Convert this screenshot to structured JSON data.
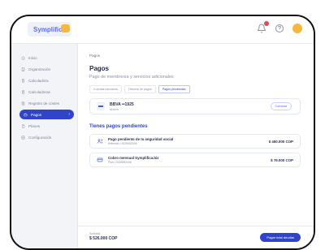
{
  "app": {
    "brand": "Symplifica"
  },
  "nav": {
    "items": [
      {
        "label": "Inicio",
        "icon": "home-icon"
      },
      {
        "label": "Organización",
        "icon": "building-icon"
      },
      {
        "label": "Calculadora",
        "icon": "calculator-icon"
      },
      {
        "label": "Calculadoras",
        "icon": "calculator-icon"
      },
      {
        "label": "Registro de costes",
        "icon": "ledger-icon"
      },
      {
        "label": "Pagos",
        "icon": "wallet-icon",
        "active": true
      },
      {
        "label": "Planes",
        "icon": "document-icon"
      },
      {
        "label": "Configuración",
        "icon": "gear-icon"
      }
    ]
  },
  "page": {
    "breadcrumb": "Pagos",
    "title": "Pagos",
    "subtitle": "Pago de membresía y servicios adicionales",
    "tabs": [
      "Cuentas bancarias",
      "Historial de pagos",
      "Pagos pendientes"
    ]
  },
  "bank": {
    "name": "BBVA ••1925",
    "sub": "Ahorro",
    "action": "Cambiar"
  },
  "pending": {
    "title": "Tienes pagos pendientes",
    "items": [
      {
        "title": "Pago pendiente de tu seguridad social",
        "sub": "Retenido • 0029052006",
        "amount": "$ 450.000 COP",
        "icon": "people-icon"
      },
      {
        "title": "Cobro mensual Symplifica.biz",
        "sub": "Plan • 0029052006",
        "amount": "$ 76.000 COP",
        "icon": "card-icon"
      }
    ]
  },
  "footer": {
    "subtotal_label": "Subtotal",
    "subtotal_value": "$ 526.000 COP",
    "button": "Pagar total deudas"
  }
}
